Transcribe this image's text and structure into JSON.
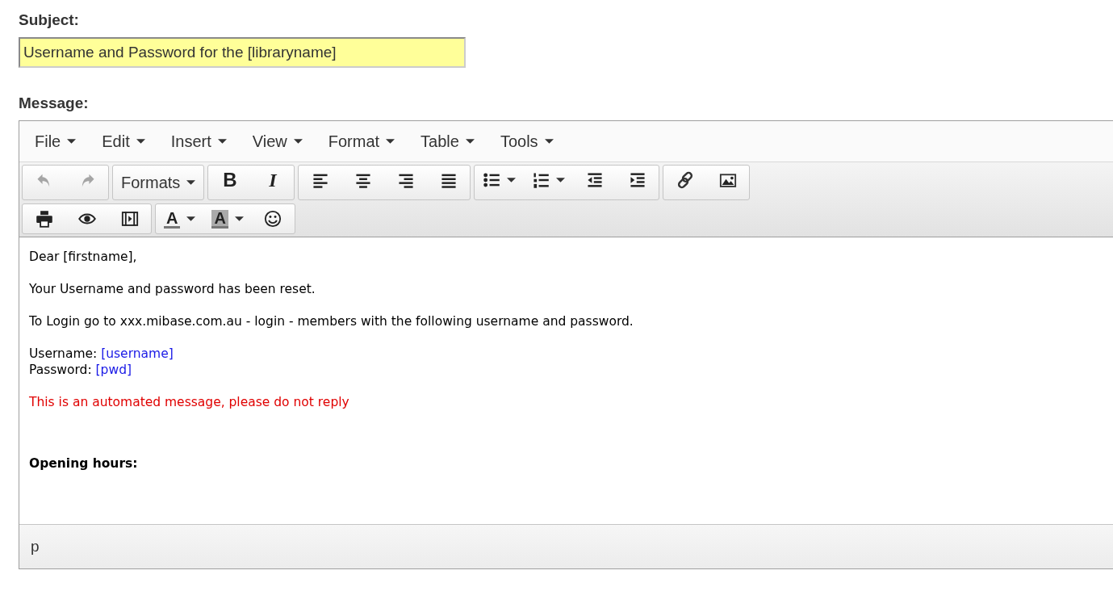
{
  "subject": {
    "label": "Subject:",
    "value": "Username and Password for the [libraryname]"
  },
  "message": {
    "label": "Message:",
    "menubar": [
      {
        "label": "File"
      },
      {
        "label": "Edit"
      },
      {
        "label": "Insert"
      },
      {
        "label": "View"
      },
      {
        "label": "Format"
      },
      {
        "label": "Table"
      },
      {
        "label": "Tools"
      }
    ],
    "toolbar_rows": [
      [
        [
          {
            "kind": "undo",
            "disabled": true
          },
          {
            "kind": "redo",
            "disabled": true
          }
        ],
        [
          {
            "kind": "text",
            "label": "Formats",
            "dropdown": true
          }
        ],
        [
          {
            "kind": "bold",
            "glyph": "B"
          },
          {
            "kind": "italic",
            "glyph": "I"
          }
        ],
        [
          {
            "kind": "align-left"
          },
          {
            "kind": "align-center"
          },
          {
            "kind": "align-right"
          },
          {
            "kind": "justify"
          }
        ],
        [
          {
            "kind": "bullets",
            "dropdown": true
          },
          {
            "kind": "numbers",
            "dropdown": true
          },
          {
            "kind": "outdent"
          },
          {
            "kind": "indent"
          }
        ],
        [
          {
            "kind": "link"
          },
          {
            "kind": "image"
          }
        ]
      ],
      [
        [
          {
            "kind": "print"
          },
          {
            "kind": "preview"
          },
          {
            "kind": "media"
          }
        ],
        [
          {
            "kind": "text-color",
            "glyph": "A",
            "dropdown": true
          },
          {
            "kind": "highlight",
            "glyph": "A",
            "dropdown": true
          },
          {
            "kind": "emoji"
          }
        ]
      ]
    ],
    "body": [
      {
        "kind": "normal",
        "lines": [
          [
            {
              "kind": "plain",
              "text": "Dear [firstname],"
            }
          ]
        ]
      },
      {
        "kind": "normal",
        "lines": [
          [
            {
              "kind": "plain",
              "text": "Your Username and password has been reset."
            }
          ]
        ]
      },
      {
        "kind": "normal",
        "lines": [
          [
            {
              "kind": "plain",
              "text": "To Login go to xxx.mibase.com.au - login - members with the following username and password."
            }
          ]
        ]
      },
      {
        "kind": "normal",
        "lines": [
          [
            {
              "kind": "plain",
              "text": "Username: "
            },
            {
              "kind": "merge-field",
              "text": "[username]"
            }
          ],
          [
            {
              "kind": "plain",
              "text": "Password: "
            },
            {
              "kind": "merge-field",
              "text": "[pwd]"
            }
          ]
        ]
      },
      {
        "kind": "warning",
        "lines": [
          [
            {
              "kind": "plain",
              "text": "This is an automated message, please do not reply"
            }
          ]
        ]
      },
      {
        "kind": "heading",
        "lines": [
          [
            {
              "kind": "plain",
              "text": "Opening hours:"
            }
          ]
        ]
      }
    ],
    "status_path": "p"
  }
}
